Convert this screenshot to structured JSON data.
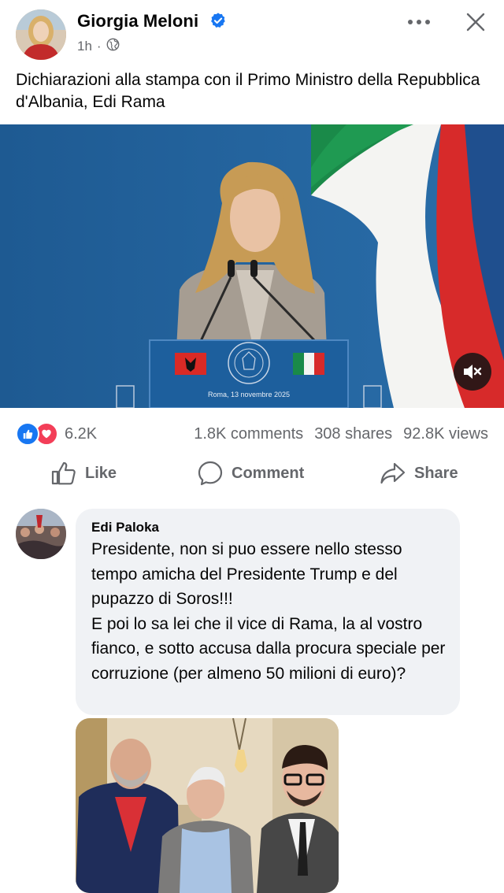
{
  "post": {
    "author": "Giorgia Meloni",
    "time": "1h",
    "separator": "·",
    "caption": "Dichiarazioni alla stampa con il Primo Ministro della Repubblica d'Albania, Edi Rama",
    "video": {
      "podium_text": "Roma, 13 novembre 2025"
    }
  },
  "stats": {
    "reactions": "6.2K",
    "comments": "1.8K comments",
    "shares": "308 shares",
    "views": "92.8K views"
  },
  "actions": {
    "like": "Like",
    "comment": "Comment",
    "share": "Share"
  },
  "comment": {
    "author": "Edi Paloka",
    "text": "Presidente, non si puo essere nello stesso tempo amicha del Presidente Trump e del pupazzo di Soros!!!\nE poi lo sa lei che il vice di Rama, la al vostro fianco, e sotto accusa dalla procura speciale per corruzione (per almeno 50 milioni di euro)?"
  },
  "colors": {
    "brand_blue": "#1877f2",
    "love_red": "#f33e58",
    "muted_text": "#65676b",
    "bubble_bg": "#f0f2f5"
  }
}
